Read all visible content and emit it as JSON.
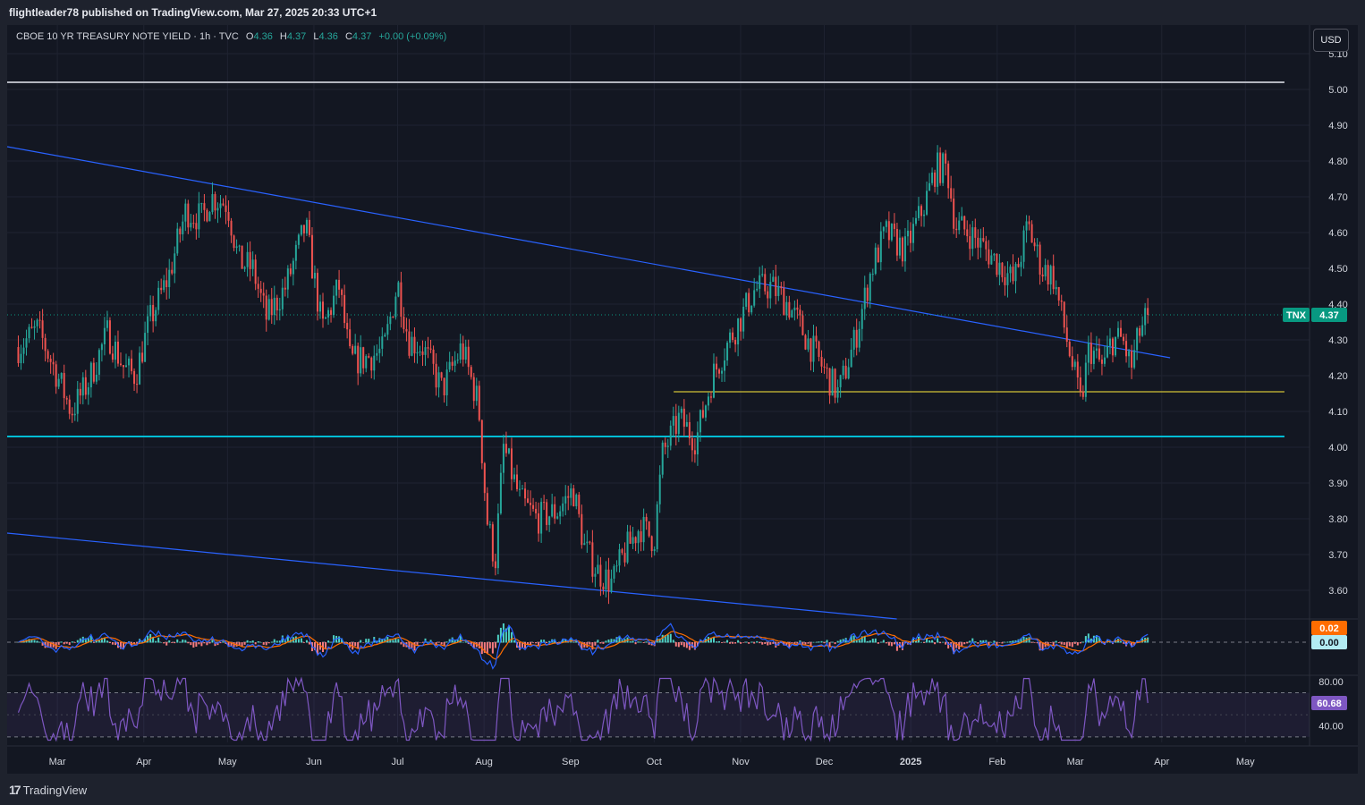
{
  "header": {
    "publisher_text": "flightleader78 published on TradingView.com, Mar 27, 2025 20:33 UTC+1"
  },
  "legend": {
    "symbol_text": "CBOE 10 YR TREASURY NOTE YIELD · 1h · TVC",
    "open_label": "O",
    "open": "4.36",
    "high_label": "H",
    "high": "4.37",
    "low_label": "L",
    "low": "4.36",
    "close_label": "C",
    "close": "4.37",
    "change": "+0.00 (+0.09%)"
  },
  "currency_label": "USD",
  "footer": {
    "brand": "TradingView",
    "logo_text": "17"
  },
  "colors": {
    "up": "#26a69a",
    "down": "#ef5350",
    "trendline": "#2962ff",
    "support_cyan": "#00bcd4",
    "support_yellow": "#ffeb3b",
    "resistance_gray": "#b2b5be",
    "rsi": "#7e57c2",
    "macd": "#2962ff",
    "signal": "#ff6d00",
    "price_tag": "#089981"
  },
  "chart_data": [
    {
      "type": "candlestick",
      "symbol": "TNX",
      "interval": "1h",
      "last_value": 4.37,
      "last_label": "4.37",
      "tag_label": "TNX",
      "ylim": [
        3.52,
        5.18
      ],
      "y_ticks": [
        "5.10",
        "5.00",
        "4.90",
        "4.80",
        "4.70",
        "4.60",
        "4.50",
        "4.40",
        "4.30",
        "4.20",
        "4.10",
        "4.00",
        "3.90",
        "3.80",
        "3.70",
        "3.60"
      ],
      "x_ticks": [
        {
          "label": "Mar",
          "date": "2024-03-01"
        },
        {
          "label": "Apr",
          "date": "2024-04-01"
        },
        {
          "label": "May",
          "date": "2024-05-01"
        },
        {
          "label": "Jun",
          "date": "2024-06-01"
        },
        {
          "label": "Jul",
          "date": "2024-07-01"
        },
        {
          "label": "Aug",
          "date": "2024-08-01"
        },
        {
          "label": "Sep",
          "date": "2024-09-01"
        },
        {
          "label": "Oct",
          "date": "2024-10-01"
        },
        {
          "label": "Nov",
          "date": "2024-11-01"
        },
        {
          "label": "Dec",
          "date": "2024-12-01"
        },
        {
          "label": "2025",
          "date": "2025-01-01"
        },
        {
          "label": "Feb",
          "date": "2025-02-01"
        },
        {
          "label": "Mar",
          "date": "2025-03-01"
        },
        {
          "label": "Apr",
          "date": "2025-04-01"
        },
        {
          "label": "May",
          "date": "2025-05-01"
        }
      ],
      "price_path": [
        [
          "2024-02-16",
          4.28
        ],
        [
          "2024-02-23",
          4.33
        ],
        [
          "2024-03-01",
          4.2
        ],
        [
          "2024-03-06",
          4.1
        ],
        [
          "2024-03-12",
          4.18
        ],
        [
          "2024-03-19",
          4.32
        ],
        [
          "2024-03-25",
          4.22
        ],
        [
          "2024-03-29",
          4.2
        ],
        [
          "2024-04-03",
          4.35
        ],
        [
          "2024-04-10",
          4.48
        ],
        [
          "2024-04-16",
          4.66
        ],
        [
          "2024-04-22",
          4.64
        ],
        [
          "2024-04-25",
          4.7
        ],
        [
          "2024-05-01",
          4.68
        ],
        [
          "2024-05-05",
          4.52
        ],
        [
          "2024-05-10",
          4.5
        ],
        [
          "2024-05-15",
          4.36
        ],
        [
          "2024-05-22",
          4.45
        ],
        [
          "2024-05-29",
          4.62
        ],
        [
          "2024-06-04",
          4.33
        ],
        [
          "2024-06-10",
          4.45
        ],
        [
          "2024-06-14",
          4.24
        ],
        [
          "2024-06-20",
          4.25
        ],
        [
          "2024-06-26",
          4.27
        ],
        [
          "2024-07-01",
          4.46
        ],
        [
          "2024-07-05",
          4.3
        ],
        [
          "2024-07-10",
          4.28
        ],
        [
          "2024-07-17",
          4.16
        ],
        [
          "2024-07-24",
          4.28
        ],
        [
          "2024-07-30",
          4.12
        ],
        [
          "2024-08-02",
          3.8
        ],
        [
          "2024-08-05",
          3.68
        ],
        [
          "2024-08-08",
          4.0
        ],
        [
          "2024-08-14",
          3.85
        ],
        [
          "2024-08-20",
          3.8
        ],
        [
          "2024-08-27",
          3.82
        ],
        [
          "2024-09-02",
          3.88
        ],
        [
          "2024-09-06",
          3.72
        ],
        [
          "2024-09-11",
          3.65
        ],
        [
          "2024-09-16",
          3.62
        ],
        [
          "2024-09-20",
          3.7
        ],
        [
          "2024-09-26",
          3.78
        ],
        [
          "2024-10-01",
          3.74
        ],
        [
          "2024-10-04",
          3.98
        ],
        [
          "2024-10-10",
          4.08
        ],
        [
          "2024-10-16",
          4.02
        ],
        [
          "2024-10-22",
          4.2
        ],
        [
          "2024-10-28",
          4.3
        ],
        [
          "2024-11-01",
          4.36
        ],
        [
          "2024-11-06",
          4.44
        ],
        [
          "2024-11-12",
          4.45
        ],
        [
          "2024-11-18",
          4.4
        ],
        [
          "2024-11-25",
          4.3
        ],
        [
          "2024-12-02",
          4.2
        ],
        [
          "2024-12-06",
          4.15
        ],
        [
          "2024-12-12",
          4.3
        ],
        [
          "2024-12-18",
          4.5
        ],
        [
          "2024-12-23",
          4.6
        ],
        [
          "2024-12-30",
          4.55
        ],
        [
          "2025-01-06",
          4.68
        ],
        [
          "2025-01-10",
          4.78
        ],
        [
          "2025-01-14",
          4.78
        ],
        [
          "2025-01-17",
          4.62
        ],
        [
          "2025-01-22",
          4.6
        ],
        [
          "2025-01-28",
          4.55
        ],
        [
          "2025-02-03",
          4.5
        ],
        [
          "2025-02-07",
          4.46
        ],
        [
          "2025-02-12",
          4.62
        ],
        [
          "2025-02-17",
          4.5
        ],
        [
          "2025-02-21",
          4.48
        ],
        [
          "2025-02-26",
          4.3
        ],
        [
          "2025-03-03",
          4.12
        ],
        [
          "2025-03-06",
          4.28
        ],
        [
          "2025-03-11",
          4.22
        ],
        [
          "2025-03-14",
          4.3
        ],
        [
          "2025-03-18",
          4.3
        ],
        [
          "2025-03-21",
          4.22
        ],
        [
          "2025-03-24",
          4.32
        ],
        [
          "2025-03-27",
          4.37
        ]
      ],
      "lines": [
        {
          "name": "upper-trendline",
          "from": [
            "2024-02-12",
            4.84
          ],
          "to": [
            "2025-04-04",
            4.25
          ]
        },
        {
          "name": "lower-trendline",
          "from": [
            "2024-02-12",
            3.76
          ],
          "to": [
            "2024-12-27",
            3.52
          ]
        },
        {
          "name": "resistance-level",
          "value": 5.02,
          "from": "2024-02-12",
          "to": "2025-05-15"
        },
        {
          "name": "support-cyan-level",
          "value": 4.03,
          "from": "2024-02-12",
          "to": "2025-05-15"
        },
        {
          "name": "support-yellow-level",
          "value": 4.155,
          "from": "2024-10-08",
          "to": "2025-05-15"
        }
      ]
    },
    {
      "type": "line",
      "indicator": "MACD",
      "last_value": 0.02,
      "last_label": "0.02",
      "zero_label": "0.00",
      "series": [
        {
          "values_kind": "oscillator"
        }
      ]
    },
    {
      "type": "line",
      "indicator": "RSI",
      "last_value": 60.68,
      "last_label": "60.68",
      "ylim": [
        25,
        85
      ],
      "y_ticks": [
        "80.00",
        "40.00"
      ],
      "bands": [
        70,
        30
      ]
    }
  ]
}
